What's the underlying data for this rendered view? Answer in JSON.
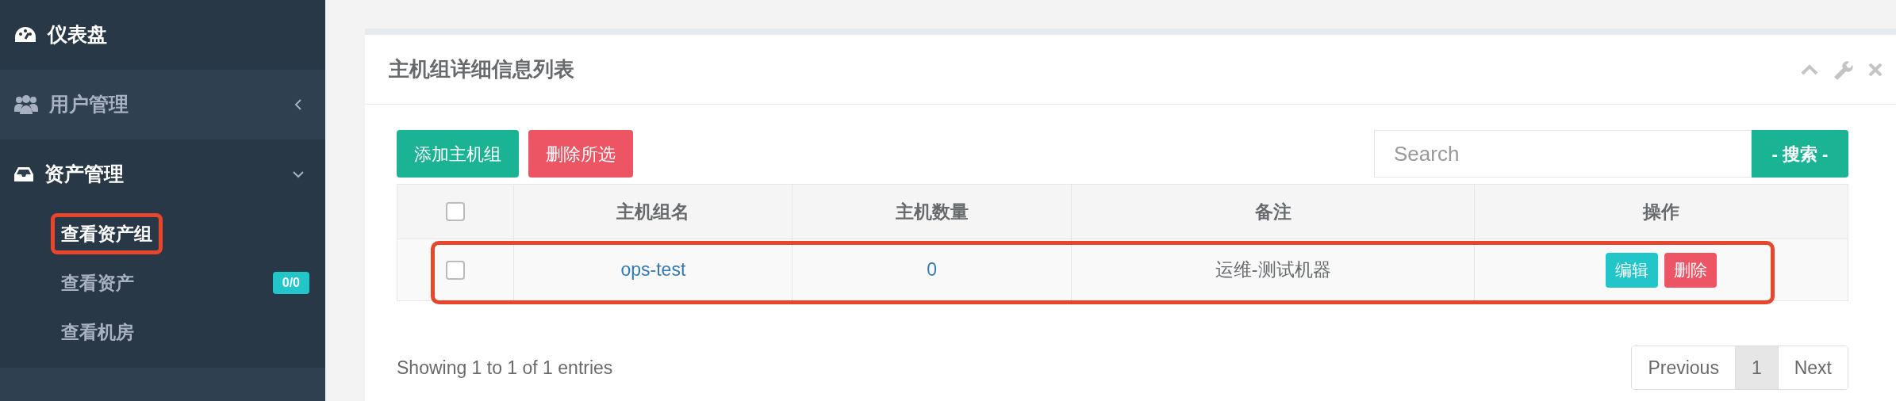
{
  "sidebar": {
    "items": [
      {
        "label": "仪表盘",
        "selected": true
      },
      {
        "label": "用户管理",
        "expanded": false,
        "selected": false
      },
      {
        "label": "资产管理",
        "expanded": true,
        "selected": true,
        "children": [
          {
            "label": "查看资产组",
            "selected": true,
            "highlighted": true
          },
          {
            "label": "查看资产",
            "selected": false,
            "highlighted": false,
            "badge": "0/0"
          },
          {
            "label": "查看机房",
            "selected": false,
            "highlighted": false
          }
        ]
      }
    ]
  },
  "panel": {
    "title": "主机组详细信息列表",
    "toolbar_buttons": [
      {
        "label": "添加主机组",
        "kind": "primary"
      },
      {
        "label": "删除所选",
        "kind": "danger"
      }
    ],
    "search": {
      "placeholder": "Search",
      "button": "- 搜索 -"
    },
    "table": {
      "select_all_checked": false,
      "columns": [
        "主机组名",
        "主机数量",
        "备注",
        "操作"
      ],
      "rows": [
        {
          "checked": false,
          "highlighted": true,
          "name": "ops-test",
          "count": "0",
          "note": "运维-测试机器",
          "actions": [
            {
              "label": "编辑",
              "kind": "info"
            },
            {
              "label": "删除",
              "kind": "danger"
            }
          ]
        }
      ]
    },
    "info": "Showing 1 to 1 of 1 entries",
    "pagination": [
      {
        "label": "Previous",
        "selected": false
      },
      {
        "label": "1",
        "selected": true
      },
      {
        "label": "Next",
        "selected": false
      }
    ]
  }
}
